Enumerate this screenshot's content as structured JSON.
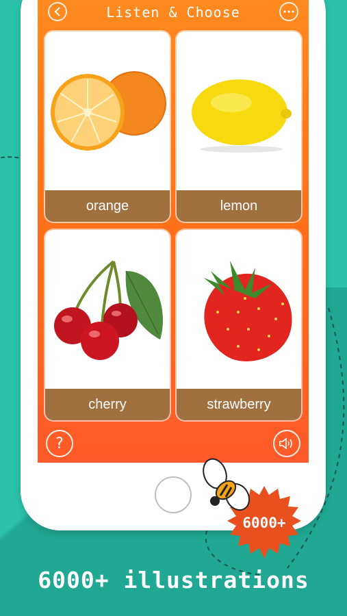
{
  "header": {
    "title": "Listen & Choose",
    "back_icon": "chevron-left-icon",
    "more_icon": "more-dots-icon"
  },
  "cards": [
    {
      "label": "orange",
      "illustration": "orange-icon"
    },
    {
      "label": "lemon",
      "illustration": "lemon-icon"
    },
    {
      "label": "cherry",
      "illustration": "cherry-icon"
    },
    {
      "label": "strawberry",
      "illustration": "strawberry-icon"
    }
  ],
  "controls": {
    "help_glyph": "?",
    "help_icon": "help-icon",
    "sound_icon": "speaker-icon"
  },
  "badge": {
    "text": "6000+",
    "color": "#e8501f"
  },
  "caption": "6000+ illustrations",
  "colors": {
    "background": "#2bc2a8",
    "screen_top": "#ff8a1f",
    "screen_bottom": "#ff5a2a",
    "label_bar": "#a0703f"
  }
}
